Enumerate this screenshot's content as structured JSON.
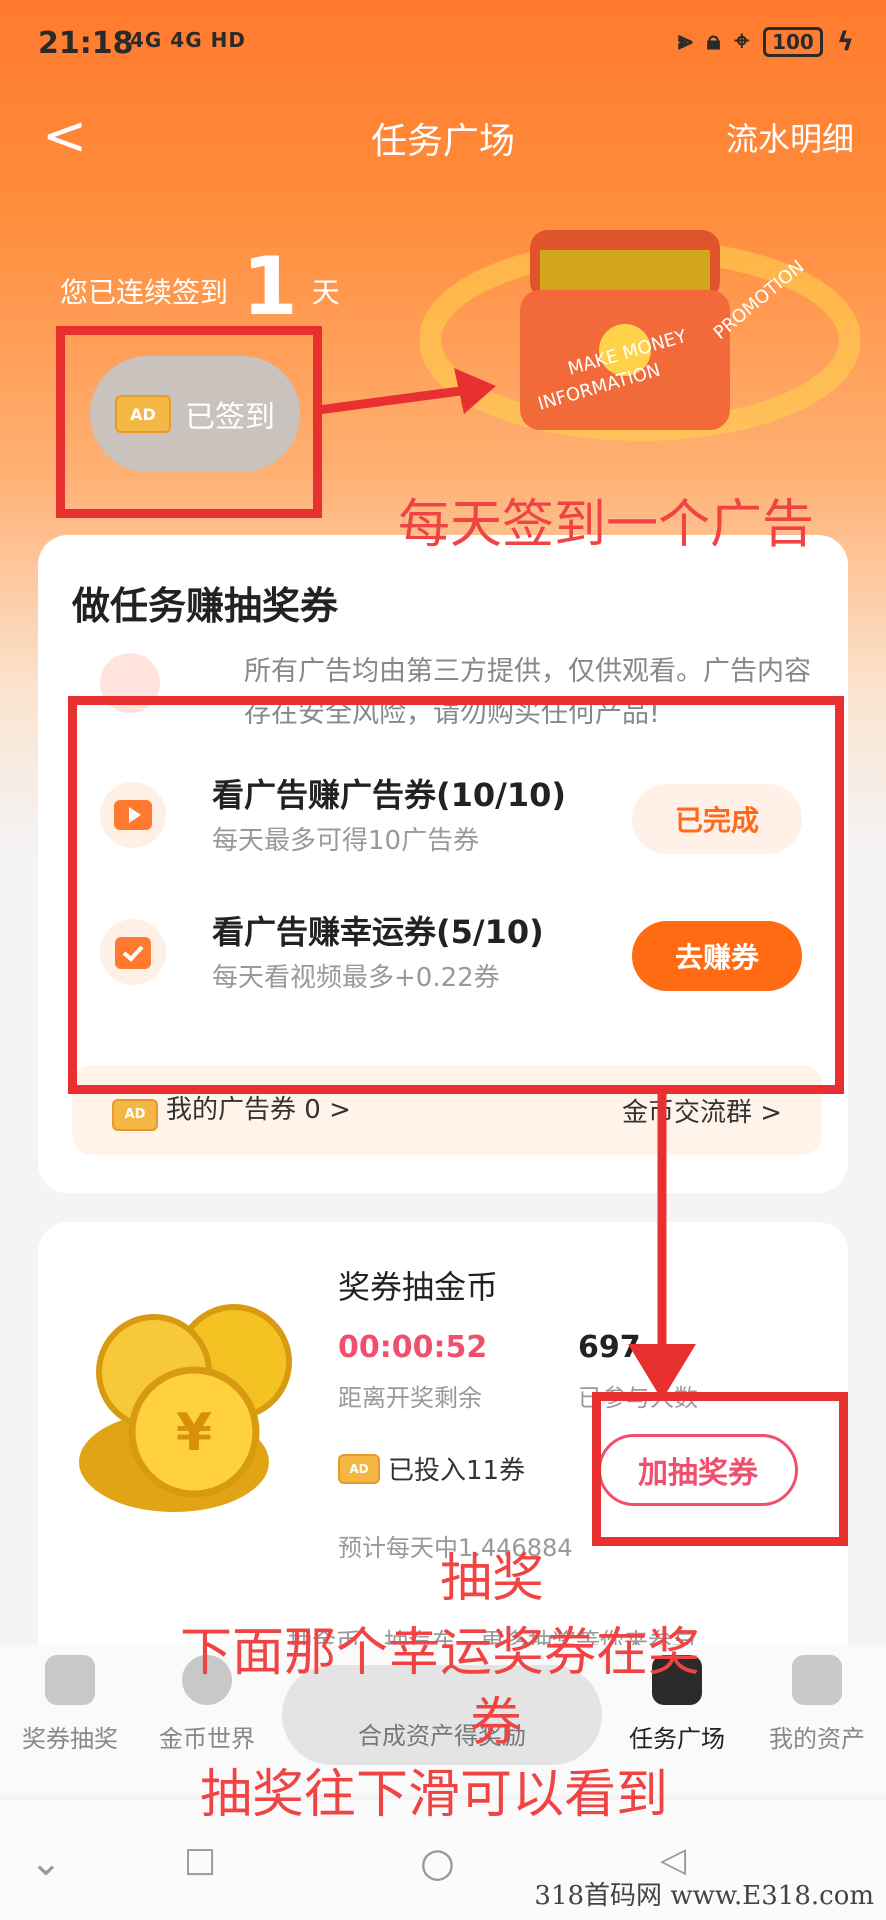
{
  "status_bar": {
    "time": "21:18",
    "network": "4G 4G HD",
    "battery": "100"
  },
  "nav": {
    "back": "<",
    "title": "任务广场",
    "right_link": "流水明细"
  },
  "checkin": {
    "prefix": "您已连续签到",
    "days": "1",
    "suffix": "天",
    "ad_tag": "AD",
    "signed_label": "已签到"
  },
  "chest_words": [
    "MAKE MONEY",
    "INFORMATION",
    "PROMOTION"
  ],
  "tasks_card": {
    "title": "做任务赚抽奖券",
    "notice": "所有广告均由第三方提供，仅供观看。广告内容存在安全风险，请勿购买任何产品!",
    "tasks": [
      {
        "name": "看广告赚广告券(10/10)",
        "sub": "每天最多可得10广告券",
        "button": "已完成"
      },
      {
        "name": "看广告赚幸运券(5/10)",
        "sub": "每天看视频最多+0.22券",
        "button": "去赚券"
      }
    ],
    "footer_left": "我的广告券 0 >",
    "footer_right": "金币交流群 >"
  },
  "lottery_card": {
    "title": "奖券抽金币",
    "countdown": "00:00:52",
    "countdown_label": "距离开奖剩余",
    "count": "697",
    "count_label": "已参与人数",
    "invested": "已投入11券",
    "button": "加抽奖券",
    "daily": "预计每天中1.446884",
    "more": "抽金币、抽汽车、更多抽奖等你来参与"
  },
  "tabbar": [
    {
      "label": "奖券抽奖",
      "active": false
    },
    {
      "label": "金币世界",
      "active": false
    },
    {
      "label": "合成资产得奖励",
      "active": false
    },
    {
      "label": "任务广场",
      "active": true
    },
    {
      "label": "我的资产",
      "active": false
    }
  ],
  "annotations": {
    "a1": "每天签到一个广告",
    "a2": "抽奖",
    "a3": "下面那个幸运奖券在奖",
    "a4": "券",
    "a5": "抽奖往下滑可以看到"
  },
  "watermark": "318首码网 www.E318.com",
  "colors": {
    "accent": "#ff6b12",
    "annotation": "#e83030",
    "lottery": "#f0506e"
  }
}
